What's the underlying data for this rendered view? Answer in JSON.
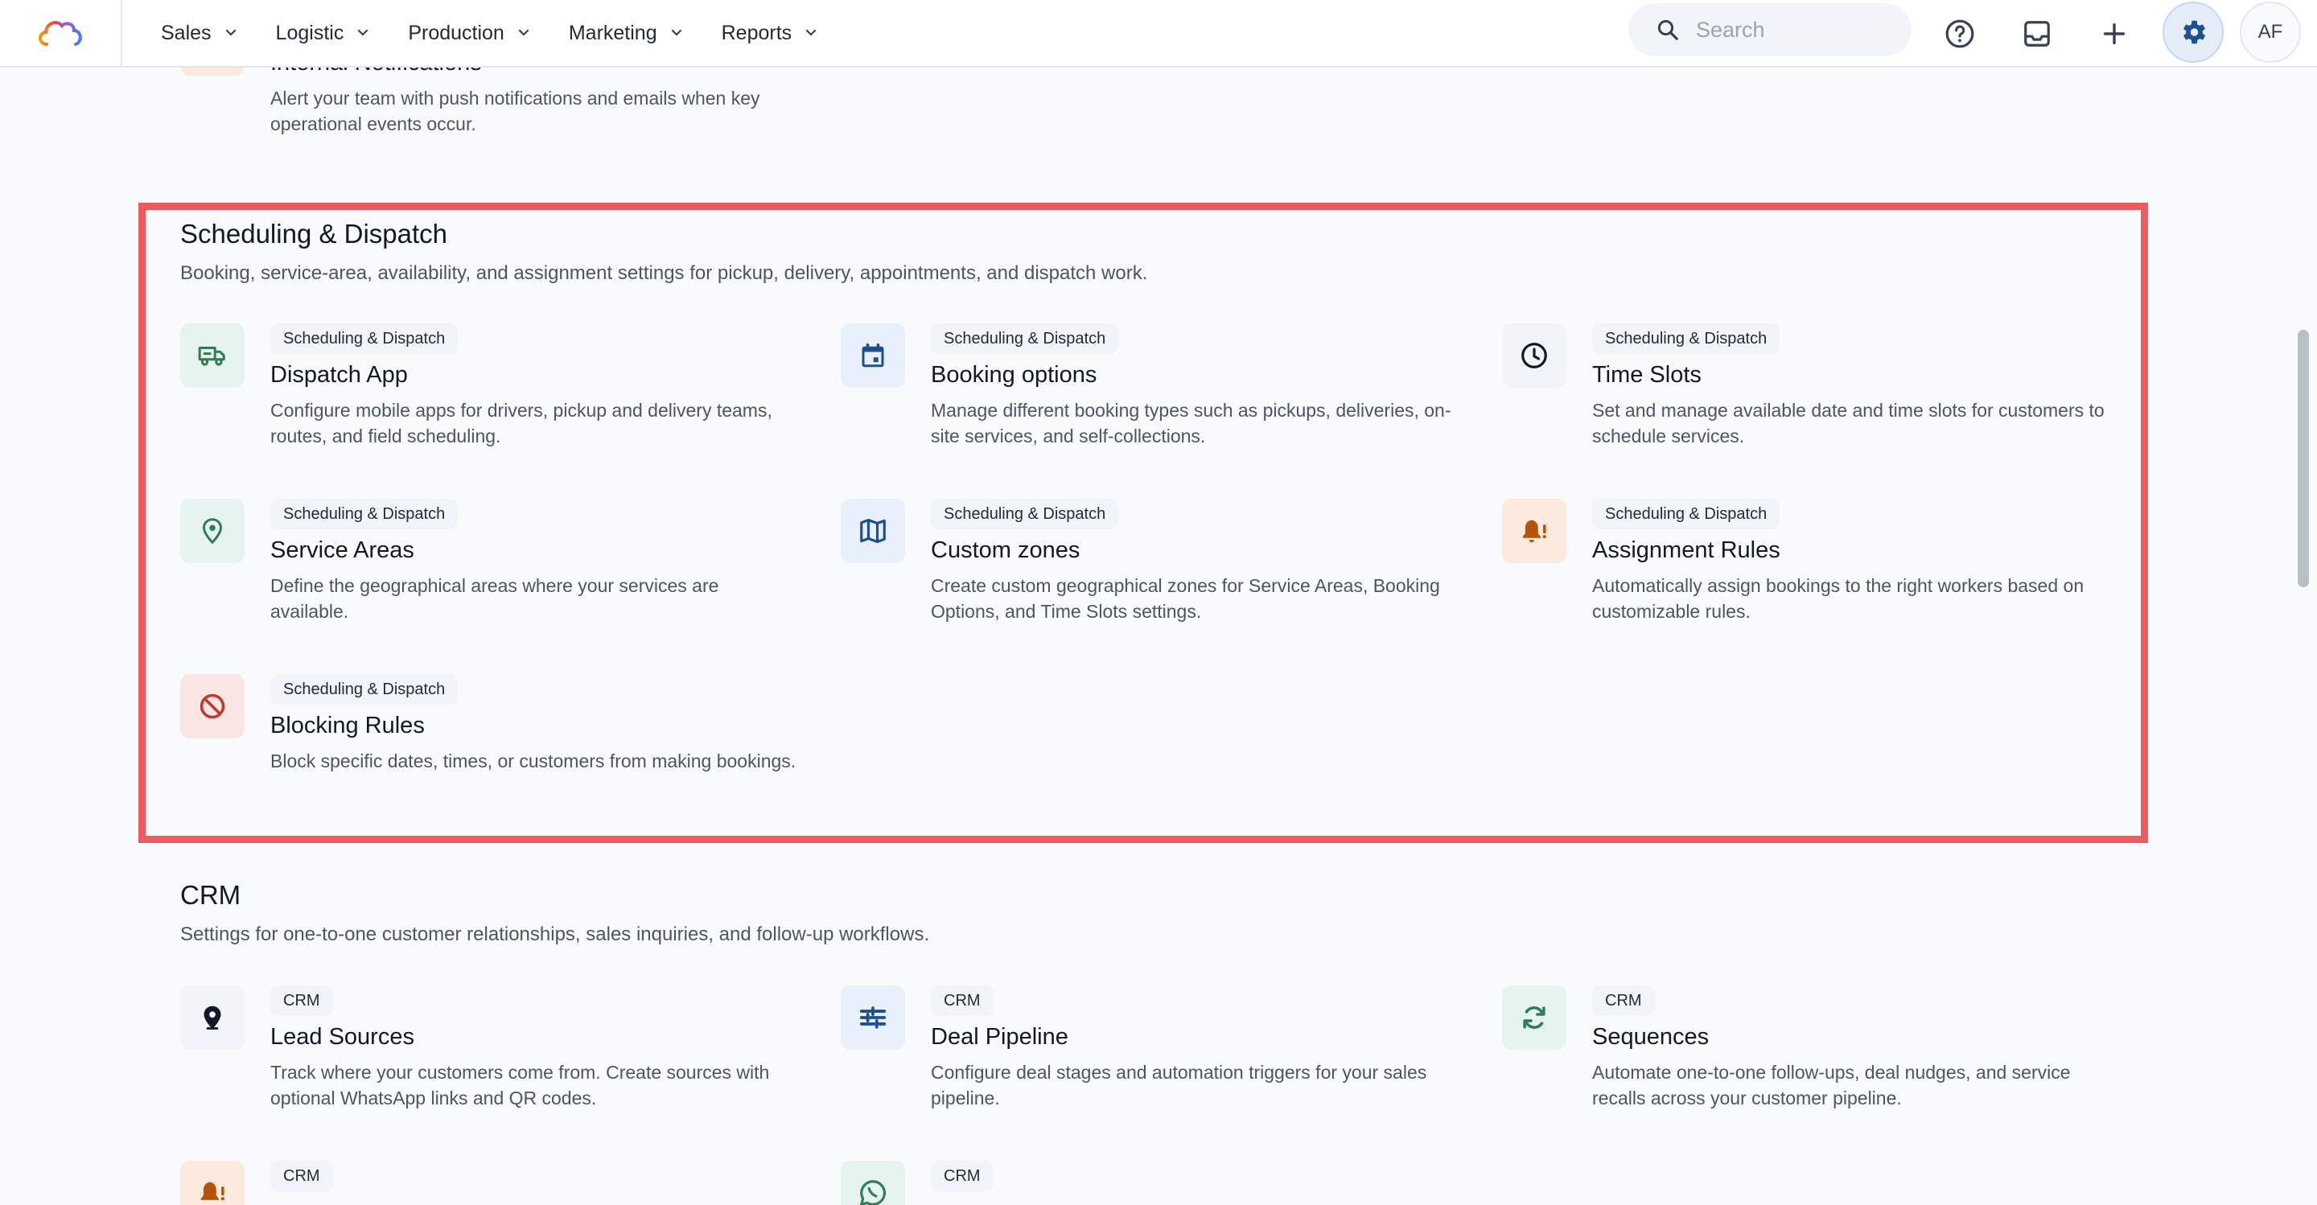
{
  "nav": {
    "items": [
      "Sales",
      "Logistic",
      "Production",
      "Marketing",
      "Reports"
    ]
  },
  "search": {
    "placeholder": "Search"
  },
  "user": {
    "initials": "AF"
  },
  "prev_section": {
    "item": {
      "title": "Internal Notifications",
      "desc": "Alert your team with push notifications and emails when key operational events occur."
    }
  },
  "scheduling": {
    "title": "Scheduling & Dispatch",
    "desc": "Booking, service-area, availability, and assignment settings for pickup, delivery, appointments, and dispatch work.",
    "items": [
      {
        "badge": "Scheduling & Dispatch",
        "title": "Dispatch App",
        "desc": "Configure mobile apps for drivers, pickup and delivery teams, routes, and field scheduling.",
        "icon": "truck-icon"
      },
      {
        "badge": "Scheduling & Dispatch",
        "title": "Booking options",
        "desc": "Manage different booking types such as pickups, deliveries, on-site services, and self-collections.",
        "icon": "calendar-icon"
      },
      {
        "badge": "Scheduling & Dispatch",
        "title": "Time Slots",
        "desc": "Set and manage available date and time slots for customers to schedule services.",
        "icon": "clock-icon"
      },
      {
        "badge": "Scheduling & Dispatch",
        "title": "Service Areas",
        "desc": "Define the geographical areas where your services are available.",
        "icon": "location-pin-icon"
      },
      {
        "badge": "Scheduling & Dispatch",
        "title": "Custom zones",
        "desc": "Create custom geographical zones for Service Areas, Booking Options, and Time Slots settings.",
        "icon": "map-icon"
      },
      {
        "badge": "Scheduling & Dispatch",
        "title": "Assignment Rules",
        "desc": "Automatically assign bookings to the right workers based on customizable rules.",
        "icon": "bell-alert-icon"
      },
      {
        "badge": "Scheduling & Dispatch",
        "title": "Blocking Rules",
        "desc": "Block specific dates, times, or customers from making bookings.",
        "icon": "block-icon"
      }
    ]
  },
  "crm": {
    "title": "CRM",
    "desc": "Settings for one-to-one customer relationships, sales inquiries, and follow-up workflows.",
    "items": [
      {
        "badge": "CRM",
        "title": "Lead Sources",
        "desc": "Track where your customers come from. Create sources with optional WhatsApp links and QR codes.",
        "icon": "location-pin-icon"
      },
      {
        "badge": "CRM",
        "title": "Deal Pipeline",
        "desc": "Configure deal stages and automation triggers for your sales pipeline.",
        "icon": "pipeline-icon"
      },
      {
        "badge": "CRM",
        "title": "Sequences",
        "desc": "Automate one-to-one follow-ups, deal nudges, and service recalls across your customer pipeline.",
        "icon": "refresh-icon"
      },
      {
        "badge": "CRM",
        "icon": "bell-alert-icon"
      },
      {
        "badge": "CRM",
        "icon": "whatsapp-icon"
      }
    ]
  },
  "colors": {
    "highlight": "#ef5a60",
    "accent": "#1e4f8f",
    "green_bg": "#e7f3ee",
    "green": "#2f7d57",
    "blue_bg": "#e8f0fb",
    "blue": "#1e4f8f",
    "orange_bg": "#fbeadd",
    "orange": "#b45309",
    "red_bg": "#fbe5e5",
    "red": "#c0392b"
  }
}
